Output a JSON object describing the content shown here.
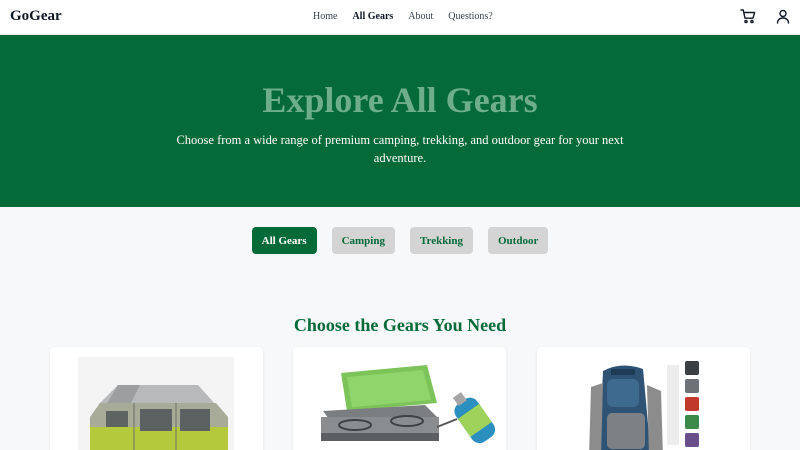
{
  "header": {
    "logo": "GoGear",
    "nav": [
      {
        "label": "Home",
        "active": false
      },
      {
        "label": "All Gears",
        "active": true
      },
      {
        "label": "About",
        "active": false
      },
      {
        "label": "Questions?",
        "active": false
      }
    ],
    "icons": [
      "cart-icon",
      "user-icon"
    ]
  },
  "hero": {
    "title": "Explore All Gears",
    "subtitle": "Choose from a wide range of premium camping, trekking, and outdoor gear for your next adventure."
  },
  "filters": [
    {
      "label": "All Gears",
      "active": true
    },
    {
      "label": "Camping",
      "active": false
    },
    {
      "label": "Trekking",
      "active": false
    },
    {
      "label": "Outdoor",
      "active": false
    }
  ],
  "section": {
    "title": "Choose the Gears You Need"
  },
  "products": [
    {
      "image": "tent-image"
    },
    {
      "image": "camping-stove-image"
    },
    {
      "image": "backpack-image"
    }
  ],
  "colors": {
    "brand": "#046a38",
    "hero_title": "#6fae8a",
    "filter_inactive": "#d4d4d4"
  }
}
